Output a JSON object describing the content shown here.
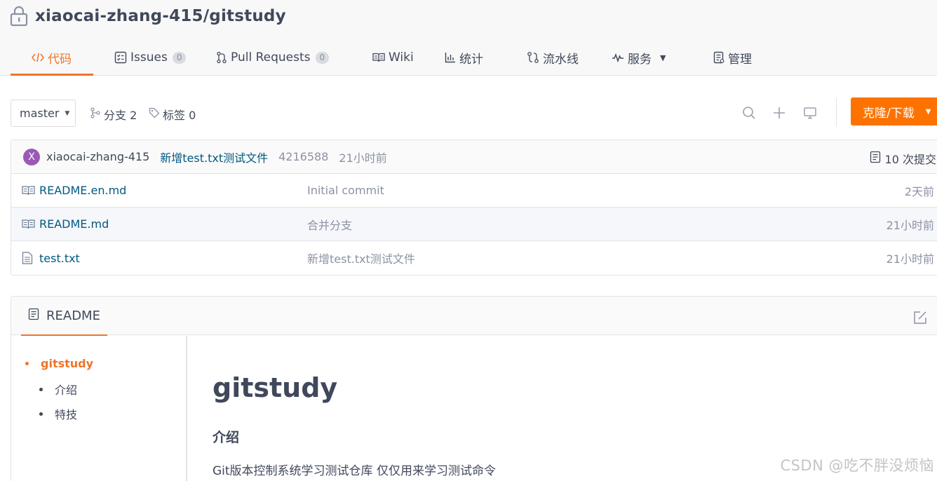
{
  "repo": {
    "title": "xiaocai-zhang-415/gitstudy"
  },
  "tabs": [
    {
      "label": "代码",
      "icon": "code-icon",
      "active": true
    },
    {
      "label": "Issues",
      "icon": "issues-icon",
      "badge": "0"
    },
    {
      "label": "Pull Requests",
      "icon": "pull-request-icon",
      "badge": "0"
    },
    {
      "label": "Wiki",
      "icon": "wiki-icon"
    },
    {
      "label": "统计",
      "icon": "stats-icon"
    },
    {
      "label": "流水线",
      "icon": "pipeline-icon"
    },
    {
      "label": "服务",
      "icon": "service-icon",
      "dropdown": true
    },
    {
      "label": "管理",
      "icon": "manage-icon"
    }
  ],
  "toolbar": {
    "branch": "master",
    "branches": "分支 2",
    "tags": "标签 0",
    "clone_label": "克隆/下载"
  },
  "last_commit": {
    "avatar": "X",
    "author": "xiaocai-zhang-415",
    "message": "新增test.txt测试文件",
    "sha": "4216588",
    "time": "21小时前",
    "count": "10 次提交"
  },
  "files": [
    {
      "name": "README.en.md",
      "icon": "book-icon",
      "commit": "Initial commit",
      "time": "2天前"
    },
    {
      "name": "README.md",
      "icon": "book-icon",
      "commit": "合并分支",
      "time": "21小时前"
    },
    {
      "name": "test.txt",
      "icon": "file-icon",
      "commit": "新增test.txt测试文件",
      "time": "21小时前"
    }
  ],
  "readme": {
    "tab_label": "README",
    "toc": [
      {
        "label": "gitstudy",
        "level": 1
      },
      {
        "label": "介绍",
        "level": 2
      },
      {
        "label": "特技",
        "level": 2
      }
    ],
    "h1": "gitstudy",
    "h2": "介绍",
    "paragraph": "Git版本控制系统学习测试仓库 仅仅用来学习测试命令"
  },
  "watermark": "CSDN @吃不胖没烦恼",
  "colors": {
    "accent": "#f0742a",
    "clone_button": "#fe7300",
    "link": "#005980",
    "muted": "#8c92a4",
    "text": "#40485b"
  }
}
